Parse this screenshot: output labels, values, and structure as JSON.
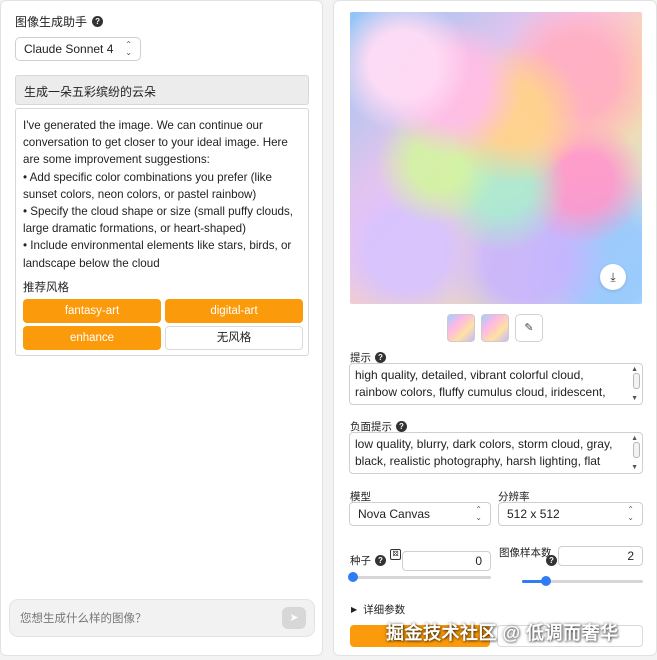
{
  "assistant": {
    "title": "图像生成助手",
    "model": "Claude Sonnet 4",
    "user_prompt": "生成一朵五彩缤纷的云朵",
    "reply_lines": [
      "I've generated the image. We can continue our conversation to get closer to your ideal image. Here are some improvement suggestions:",
      "• Add specific color combinations you prefer (like sunset colors, neon colors, or pastel rainbow)",
      "• Specify the cloud shape or size (small puffy clouds, large dramatic formations, or heart-shaped)",
      "• Include environmental elements like stars, birds, or landscape below the cloud"
    ],
    "styles_title": "推荐风格",
    "styles": [
      "fantasy-art",
      "digital-art",
      "enhance",
      "无风格"
    ],
    "chat_placeholder": "您想生成什么样的图像？"
  },
  "generator": {
    "prompt_label": "提示",
    "prompt_text": "high quality, detailed, vibrant colorful cloud, rainbow colors, fluffy cumulus cloud, iridescent,",
    "negative_label": "负面提示",
    "negative_text": "low quality, blurry, dark colors, storm cloud, gray, black, realistic photography, harsh lighting, flat",
    "model_label": "模型",
    "model_value": "Nova Canvas",
    "resolution_label": "分辨率",
    "resolution_value": "512 x 512",
    "seed_label": "种子",
    "seed_value": "0",
    "seed_slider": 0,
    "samples_label": "图像样本数",
    "samples_value": "2",
    "samples_slider": 0.2,
    "advanced_label": "详细参数"
  },
  "watermark": "掘金技术社区 @ 低调而奢华",
  "colors": {
    "accent": "#fb9a0a",
    "slider": "#2f7cf6"
  }
}
